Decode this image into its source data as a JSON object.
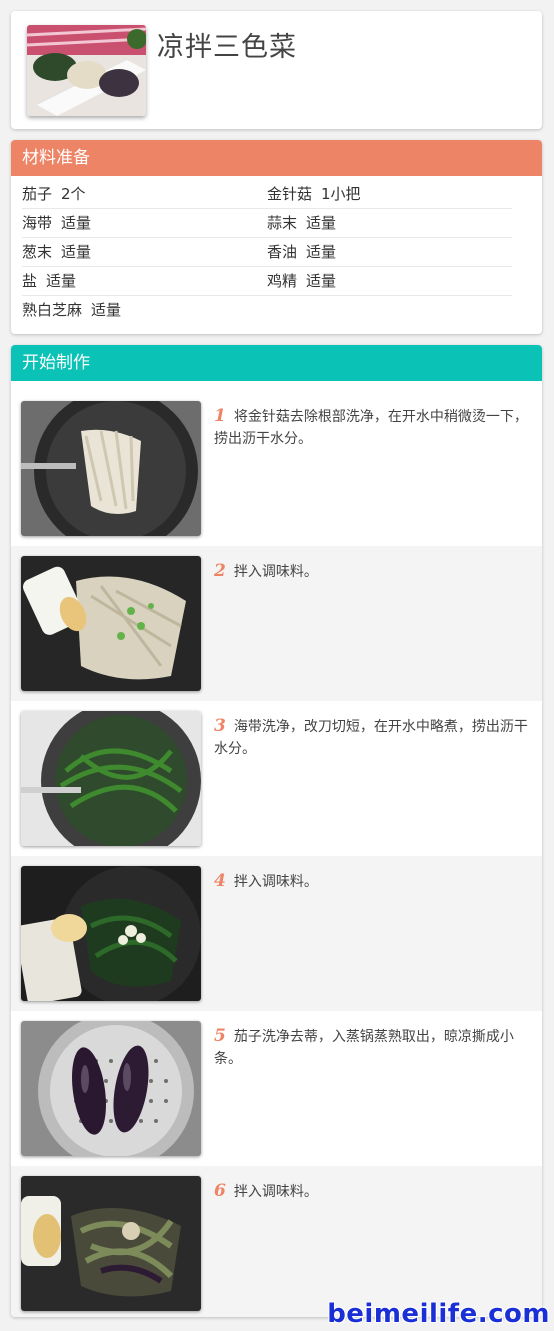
{
  "recipe": {
    "title": "凉拌三色菜",
    "thumbnail": "dish-photo"
  },
  "ingredients": {
    "heading": "材料准备",
    "accent_color": "#ee8466",
    "items": [
      {
        "name": "茄子",
        "amount": "2个"
      },
      {
        "name": "金针菇",
        "amount": "1小把"
      },
      {
        "name": "海带",
        "amount": "适量"
      },
      {
        "name": "蒜末",
        "amount": "适量"
      },
      {
        "name": "葱末",
        "amount": "适量"
      },
      {
        "name": "香油",
        "amount": "适量"
      },
      {
        "name": "盐",
        "amount": "适量"
      },
      {
        "name": "鸡精",
        "amount": "适量"
      },
      {
        "name": "熟白芝麻",
        "amount": "适量"
      }
    ]
  },
  "steps": {
    "heading": "开始制作",
    "accent_color": "#0ac2b6",
    "items": [
      {
        "num": "1",
        "text": "将金针菇去除根部洗净，在开水中稍微烫一下，捞出沥干水分。",
        "photo": "enoki-in-wok-photo"
      },
      {
        "num": "2",
        "text": "拌入调味料。",
        "photo": "seasoning-enoki-photo"
      },
      {
        "num": "3",
        "text": "海带洗净，改刀切短，在开水中略煮，捞出沥干水分。",
        "photo": "kelp-in-wok-photo"
      },
      {
        "num": "4",
        "text": "拌入调味料。",
        "photo": "seasoning-kelp-photo"
      },
      {
        "num": "5",
        "text": "茄子洗净去蒂，入蒸锅蒸熟取出，晾凉撕成小条。",
        "photo": "eggplant-steamer-photo"
      },
      {
        "num": "6",
        "text": "拌入调味料。",
        "photo": "seasoning-eggplant-photo"
      }
    ]
  },
  "watermark": "beimeilife.com"
}
